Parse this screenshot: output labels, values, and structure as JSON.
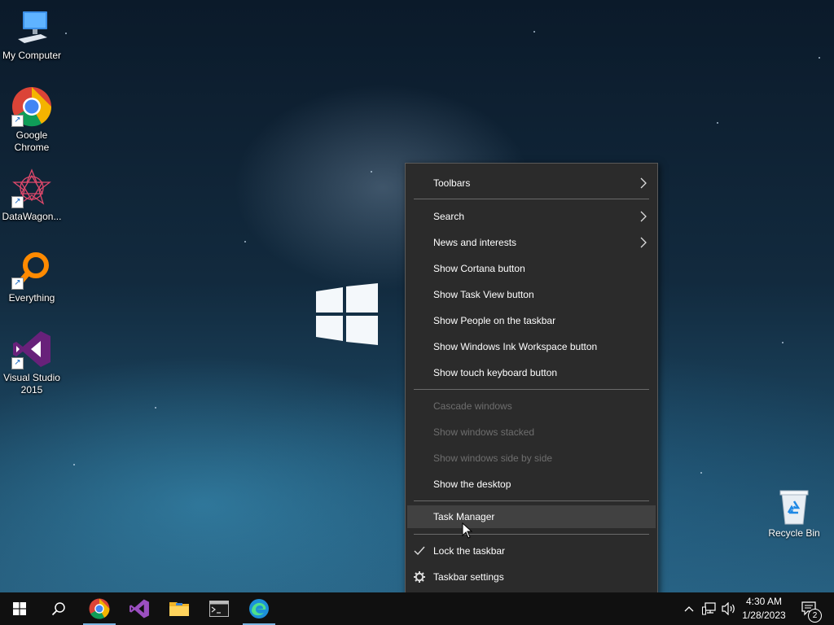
{
  "desktop": {
    "icons": [
      {
        "label": "My Computer",
        "icon": "computer-icon"
      },
      {
        "label": "Google\nChrome",
        "icon": "chrome-icon"
      },
      {
        "label": "DataWagon...",
        "icon": "datawagon-icon"
      },
      {
        "label": "Everything",
        "icon": "everything-icon"
      },
      {
        "label": "Visual Studio\n2015",
        "icon": "visual-studio-icon"
      }
    ],
    "recycle_bin": {
      "label": "Recycle Bin",
      "icon": "recycle-bin-icon"
    }
  },
  "context_menu": {
    "items": [
      {
        "label": "Toolbars",
        "submenu": true,
        "enabled": true
      },
      {
        "label": "Search",
        "submenu": true,
        "enabled": true
      },
      {
        "label": "News and interests",
        "submenu": true,
        "enabled": true
      },
      {
        "label": "Show Cortana button",
        "enabled": true
      },
      {
        "label": "Show Task View button",
        "enabled": true
      },
      {
        "label": "Show People on the taskbar",
        "enabled": true
      },
      {
        "label": "Show Windows Ink Workspace button",
        "enabled": true
      },
      {
        "label": "Show touch keyboard button",
        "enabled": true
      },
      {
        "label": "Cascade windows",
        "enabled": false
      },
      {
        "label": "Show windows stacked",
        "enabled": false
      },
      {
        "label": "Show windows side by side",
        "enabled": false
      },
      {
        "label": "Show the desktop",
        "enabled": true
      },
      {
        "label": "Task Manager",
        "enabled": true,
        "hovered": true
      },
      {
        "label": "Lock the taskbar",
        "enabled": true,
        "checked": true,
        "icon": "checkmark-icon"
      },
      {
        "label": "Taskbar settings",
        "enabled": true,
        "icon": "gear-icon"
      }
    ]
  },
  "taskbar": {
    "buttons": [
      {
        "name": "start",
        "icon": "windows-start-icon"
      },
      {
        "name": "search",
        "icon": "search-icon"
      },
      {
        "name": "chrome",
        "icon": "chrome-icon",
        "active": true
      },
      {
        "name": "visual-studio",
        "icon": "visual-studio-icon"
      },
      {
        "name": "file-explorer",
        "icon": "folder-icon"
      },
      {
        "name": "command-prompt",
        "icon": "terminal-icon"
      },
      {
        "name": "edge",
        "icon": "edge-icon",
        "active": true
      }
    ],
    "tray": {
      "time": "4:30 AM",
      "date": "1/28/2023",
      "notification_count": "2"
    }
  },
  "colors": {
    "menu_bg": "#2b2b2b",
    "menu_hover": "#414141",
    "taskbar_bg": "#101010",
    "active_indicator": "#7ab4e0"
  }
}
